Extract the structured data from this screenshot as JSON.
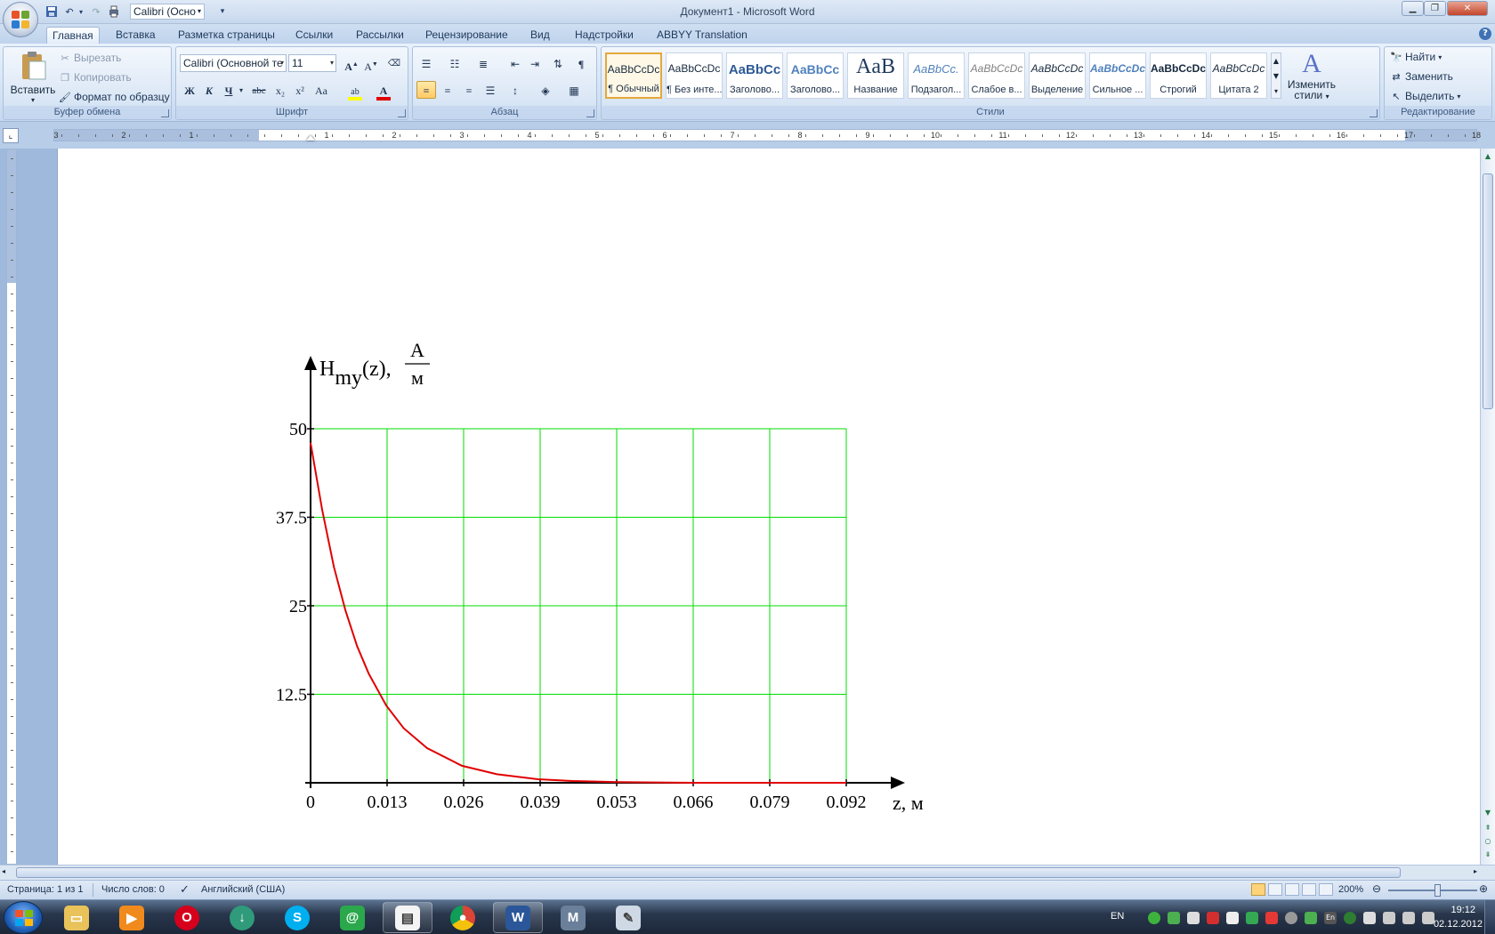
{
  "window": {
    "title": "Документ1 - Microsoft Word",
    "qat_font": "Calibri (Осно"
  },
  "tabs": [
    {
      "label": "Главная",
      "active": true
    },
    {
      "label": "Вставка"
    },
    {
      "label": "Разметка страницы"
    },
    {
      "label": "Ссылки"
    },
    {
      "label": "Рассылки"
    },
    {
      "label": "Рецензирование"
    },
    {
      "label": "Вид"
    },
    {
      "label": "Надстройки"
    },
    {
      "label": "ABBYY Translation"
    }
  ],
  "ribbon": {
    "clipboard": {
      "label": "Буфер обмена",
      "paste": "Вставить",
      "cut": "Вырезать",
      "copy": "Копировать",
      "format_painter": "Формат по образцу"
    },
    "font": {
      "label": "Шрифт",
      "font_name": "Calibri (Основной те",
      "font_size": "11",
      "bold": "Ж",
      "italic": "К",
      "underline": "Ч",
      "strike": "abc",
      "subscript": "x₂",
      "superscript": "x²",
      "case": "Aa",
      "grow": "A",
      "shrink": "A"
    },
    "paragraph": {
      "label": "Абзац",
      "pilcrow": "¶"
    },
    "styles": {
      "label": "Стили",
      "items": [
        {
          "sample": "AaBbCcDc",
          "name": "¶ Обычный"
        },
        {
          "sample": "AaBbCcDc",
          "name": "¶ Без инте..."
        },
        {
          "sample": "AaBbCc",
          "name": "Заголово..."
        },
        {
          "sample": "AaBbCc",
          "name": "Заголово..."
        },
        {
          "sample": "AaB",
          "name": "Название"
        },
        {
          "sample": "AaBbCc.",
          "name": "Подзагол..."
        },
        {
          "sample": "AaBbCcDc",
          "name": "Слабое в..."
        },
        {
          "sample": "AaBbCcDc",
          "name": "Выделение"
        },
        {
          "sample": "AaBbCcDc",
          "name": "Сильное ..."
        },
        {
          "sample": "AaBbCcDc",
          "name": "Строгий"
        },
        {
          "sample": "AaBbCcDc",
          "name": "Цитата 2"
        }
      ],
      "change_styles_line1": "Изменить",
      "change_styles_line2": "стили"
    },
    "editing": {
      "label": "Редактирование",
      "find": "Найти",
      "replace": "Заменить",
      "select": "Выделить"
    }
  },
  "ruler": {
    "left_numbers": [
      "3",
      "2",
      "1"
    ],
    "right_numbers": [
      "1",
      "2",
      "3",
      "4",
      "5",
      "6",
      "7",
      "8",
      "9",
      "10",
      "11",
      "12",
      "13",
      "14",
      "15",
      "16",
      "17",
      "18"
    ]
  },
  "chart_data": {
    "type": "line",
    "ylabel_main": "H",
    "ylabel_sub": "my",
    "ylabel_arg": "(z),",
    "ylabel_unit_num": "A",
    "ylabel_unit_den": "м",
    "xlabel": "z, м",
    "x_ticks": [
      "0",
      "0.013",
      "0.026",
      "0.039",
      "0.053",
      "0.066",
      "0.079",
      "0.092"
    ],
    "y_ticks": [
      "12.5",
      "25",
      "37.5",
      "50"
    ],
    "xlim": [
      0,
      0.092
    ],
    "ylim": [
      0,
      50
    ],
    "grid": true,
    "grid_color": "#00dd00",
    "line_color": "#e00000",
    "series": [
      {
        "x": [
          0,
          0.002,
          0.004,
          0.006,
          0.008,
          0.01,
          0.013,
          0.016,
          0.02,
          0.026,
          0.032,
          0.039,
          0.045,
          0.053,
          0.066,
          0.079,
          0.092
        ],
        "y": [
          48,
          38.5,
          30.5,
          24.3,
          19.3,
          15.4,
          10.9,
          7.7,
          4.9,
          2.4,
          1.2,
          0.5,
          0.25,
          0.1,
          0,
          0,
          0
        ]
      }
    ]
  },
  "status": {
    "page": "Страница: 1 из 1",
    "words": "Число слов: 0",
    "language": "Английский (США)",
    "zoom": "200%"
  },
  "taskbar": {
    "lang": "EN",
    "time": "19:12",
    "date": "02.12.2012"
  },
  "colors": {
    "accent": "#2b579a",
    "ribbon_bg": "#d2e1f3",
    "grid": "#00dd00",
    "curve": "#e00000"
  }
}
